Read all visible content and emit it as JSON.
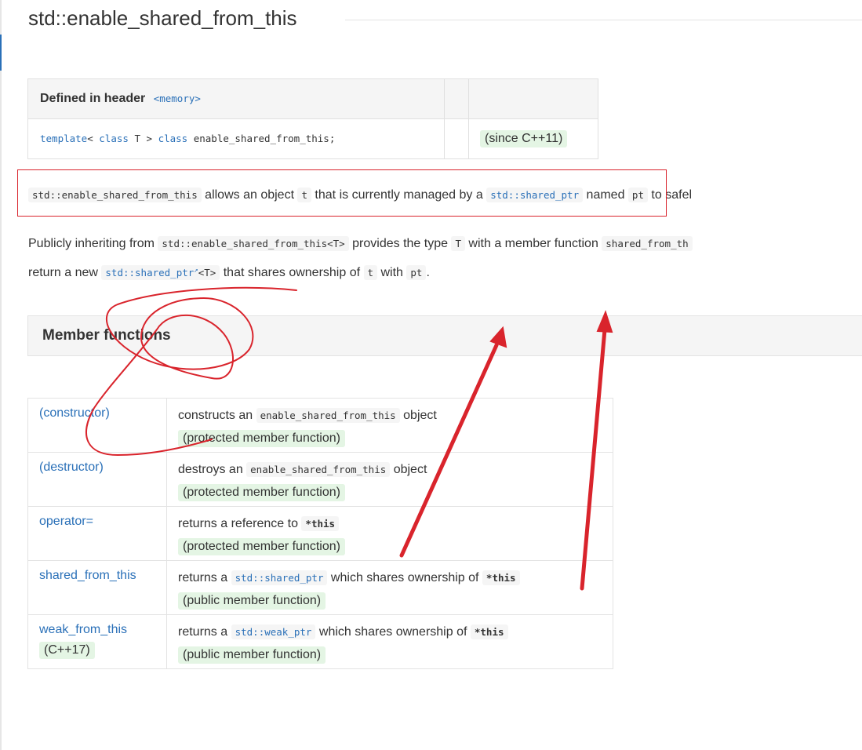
{
  "page": {
    "title": "std::enable_shared_from_this"
  },
  "header_table": {
    "defined_label": "Defined in header",
    "header": "<memory>",
    "decl_template_kw": "template",
    "decl_lt": "< ",
    "decl_class_kw": "class",
    "decl_T": " T > ",
    "decl_class_kw2": "class",
    "decl_rest": " enable_shared_from_this;",
    "since": "(since C++11)"
  },
  "paragraph1": {
    "p1_code1": "std::enable_shared_from_this",
    "p1_t1": " allows an object ",
    "p1_code2": "t",
    "p1_t2": " that is currently managed by a ",
    "p1_link": "std::shared_ptr",
    "p1_t3": " named ",
    "p1_code3": "pt",
    "p1_t4": " to safel"
  },
  "paragraph2": {
    "l1_t1": "Publicly inheriting from ",
    "l1_code1": "std::enable_shared_from_this<T>",
    "l1_t2": " provides the type ",
    "l1_code2": "T",
    "l1_t3": " with a member function ",
    "l1_code3": "shared_from_th",
    "l2_t1": "return a new ",
    "l2_link": "std::shared_ptr",
    "l2_code_suffix": "<T>",
    "l2_t2": " that shares ownership of ",
    "l2_code2": "t",
    "l2_t3": " with ",
    "l2_code3": "pt",
    "l2_t4": "."
  },
  "member_functions": {
    "heading": "Member functions",
    "rows": [
      {
        "name": "(constructor)",
        "d1": "constructs an ",
        "code": "enable_shared_from_this",
        "d2": " object",
        "tag": "(protected member function)"
      },
      {
        "name": "(destructor)",
        "d1": "destroys an ",
        "code": "enable_shared_from_this",
        "d2": " object",
        "tag": "(protected member function)"
      },
      {
        "name": "operator=",
        "d1": "returns a reference to ",
        "code": "*this",
        "d2": "",
        "tag": "(protected member function)"
      },
      {
        "name": "shared_from_this",
        "d1": "returns a ",
        "link": "std::shared_ptr",
        "d2": " which shares ownership of ",
        "code": "*this",
        "tag": "(public member function)"
      },
      {
        "name": "weak_from_this",
        "name_tag": "(C++17)",
        "d1": "returns a ",
        "link": "std::weak_ptr",
        "d2": " which shares ownership of ",
        "code": "*this",
        "tag": "(public member function)"
      }
    ]
  },
  "colors": {
    "link": "#2a70b8",
    "tag_bg": "#e4f5e4",
    "annotation": "#d9242c"
  }
}
